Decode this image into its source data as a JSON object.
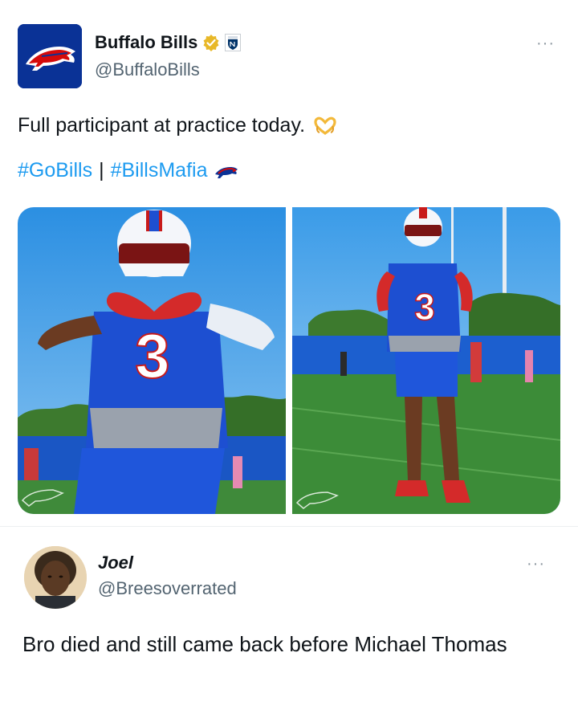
{
  "post": {
    "author": {
      "display_name": "Buffalo Bills",
      "handle": "@BuffaloBills",
      "verified": true,
      "badges": [
        "gold-verified-icon",
        "nfl-shield-icon"
      ]
    },
    "more_label": "···",
    "text": "Full participant at practice today.",
    "text_emoji": "heart-hands-emoji",
    "hashtags": [
      "#GoBills",
      "#BillsMafia"
    ],
    "hashtag_separator": "|",
    "media_count": 2,
    "player_number": "3"
  },
  "reply": {
    "author": {
      "display_name": "Joel",
      "handle": "@Breesoverrated"
    },
    "more_label": "···",
    "text": "Bro died and still came back before Michael Thomas"
  },
  "colors": {
    "bills_blue": "#0a3296",
    "bills_red": "#d50a0a",
    "link_blue": "#1d9bf0",
    "secondary_text": "#536471"
  }
}
